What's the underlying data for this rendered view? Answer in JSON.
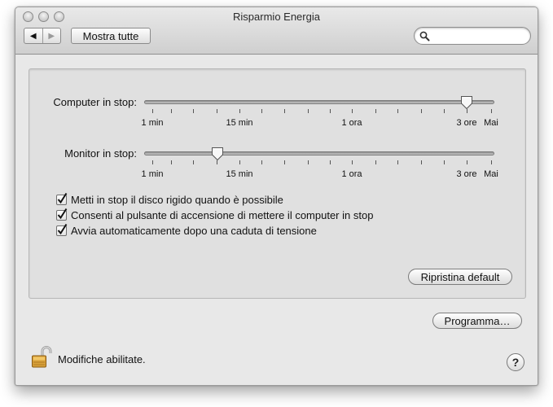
{
  "window": {
    "title": "Risparmio Energia"
  },
  "toolbar": {
    "back": "◀",
    "forward": "▶",
    "show_all": "Mostra tutte"
  },
  "search": {
    "value": "",
    "placeholder": ""
  },
  "sliders": {
    "computer": {
      "label": "Computer in stop:",
      "value_fraction": 0.92
    },
    "monitor": {
      "label": "Monitor in stop:",
      "value_fraction": 0.21
    },
    "scale_labels": [
      "1 min",
      "15 min",
      "1 ora",
      "3 ore",
      "Mai"
    ]
  },
  "options": {
    "disk_sleep": {
      "label": "Metti in stop il disco rigido quando è possibile",
      "checked": true
    },
    "power_button": {
      "label": "Consenti al pulsante di accensione di mettere il computer in stop",
      "checked": true
    },
    "auto_restart": {
      "label": "Avvia automaticamente dopo una caduta di tensione",
      "checked": true
    }
  },
  "buttons": {
    "reset": "Ripristina default",
    "schedule": "Programma…",
    "help": "?"
  },
  "footer": {
    "lock_status": "Modifiche abilitate."
  }
}
